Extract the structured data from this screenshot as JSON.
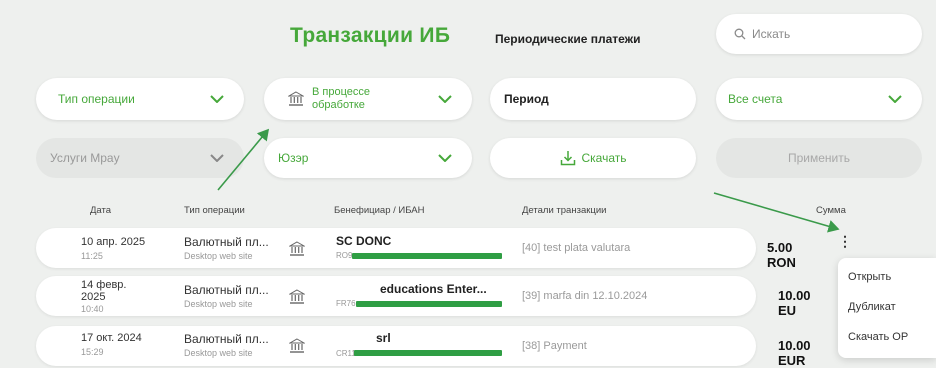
{
  "tabs": {
    "active": "Транзакции ИБ",
    "periodic": "Периодические платежи"
  },
  "search": {
    "placeholder": "Искать"
  },
  "filters": {
    "operation_type": "Тип операции",
    "status": "В процессе обработке",
    "period": "Период",
    "accounts": "Все счета",
    "service": "Услуги Mpay",
    "user": "Юзэр",
    "download": "Скачать",
    "apply": "Применить"
  },
  "columns": {
    "date": "Дата",
    "type": "Тип операции",
    "beneficiary": "Бенефициар / ИБАН",
    "details": "Детали транзакции",
    "amount": "Сумма"
  },
  "rows": [
    {
      "date_lines": [
        "10 апр. 2025"
      ],
      "time": "11:25",
      "op": "Валютный пл...",
      "channel": "Desktop web site",
      "beneficiary": "SC DONC",
      "iban": "RO9",
      "details": "[40] test plata valutara",
      "amount": "5.00 RON"
    },
    {
      "date_lines": [
        "14 февр.",
        "2025"
      ],
      "time": "10:40",
      "op": "Валютный пл...",
      "channel": "Desktop web site",
      "beneficiary": "educations Enter...",
      "iban": "FR76",
      "details": "[39] marfa din 12.10.2024",
      "amount": "10.00 EU"
    },
    {
      "date_lines": [
        "17 окт. 2024"
      ],
      "time": "15:29",
      "op": "Валютный пл...",
      "channel": "Desktop web site",
      "beneficiary": "srl",
      "iban": "CR11",
      "details": "[38] Payment",
      "amount": "10.00 EUR"
    }
  ],
  "context_menu": {
    "open": "Открыть",
    "duplicate": "Дубликат",
    "download_op": "Скачать ОР"
  },
  "colors": {
    "accent": "#46a83a",
    "arrow": "#3a9a4a",
    "iban_redaction": "#2f9e44"
  }
}
